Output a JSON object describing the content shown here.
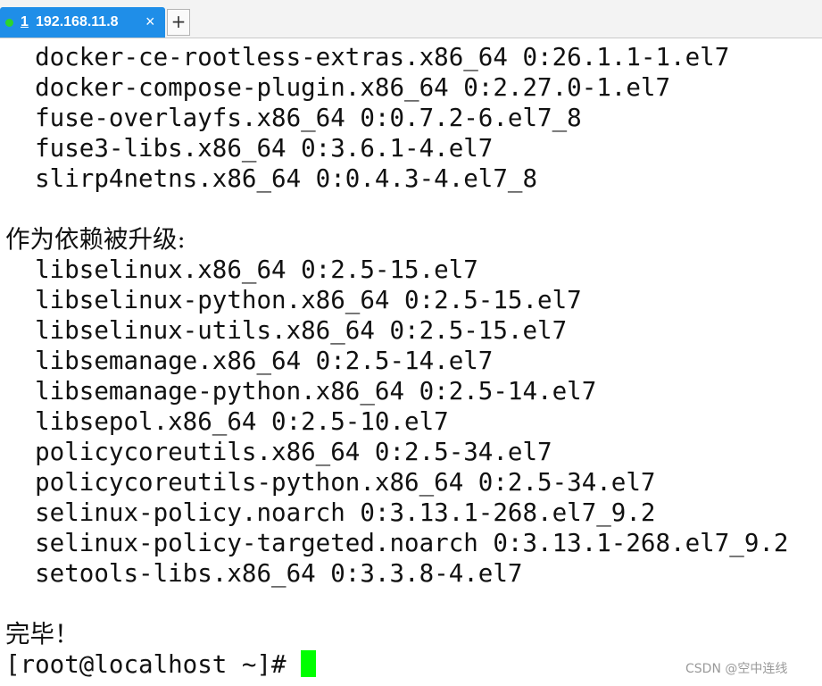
{
  "tabs": [
    {
      "index": "1",
      "title": "192.168.11.8",
      "close": "×",
      "status_color": "#2cd52c"
    }
  ],
  "new_tab_label": "+",
  "terminal": {
    "lines": [
      "  docker-ce-rootless-extras.x86_64 0:26.1.1-1.el7",
      "  docker-compose-plugin.x86_64 0:2.27.0-1.el7",
      "  fuse-overlayfs.x86_64 0:0.7.2-6.el7_8",
      "  fuse3-libs.x86_64 0:3.6.1-4.el7",
      "  slirp4netns.x86_64 0:0.4.3-4.el7_8",
      "",
      "作为依赖被升级:",
      "  libselinux.x86_64 0:2.5-15.el7",
      "  libselinux-python.x86_64 0:2.5-15.el7",
      "  libselinux-utils.x86_64 0:2.5-15.el7",
      "  libsemanage.x86_64 0:2.5-14.el7",
      "  libsemanage-python.x86_64 0:2.5-14.el7",
      "  libsepol.x86_64 0:2.5-10.el7",
      "  policycoreutils.x86_64 0:2.5-34.el7",
      "  policycoreutils-python.x86_64 0:2.5-34.el7",
      "  selinux-policy.noarch 0:3.13.1-268.el7_9.2",
      "  selinux-policy-targeted.noarch 0:3.13.1-268.el7_9.2",
      "  setools-libs.x86_64 0:3.3.8-4.el7",
      "",
      "完毕！"
    ],
    "prompt": "[root@localhost ~]#",
    "cursor_color": "#00ff00"
  },
  "watermark": "CSDN @空中连线"
}
